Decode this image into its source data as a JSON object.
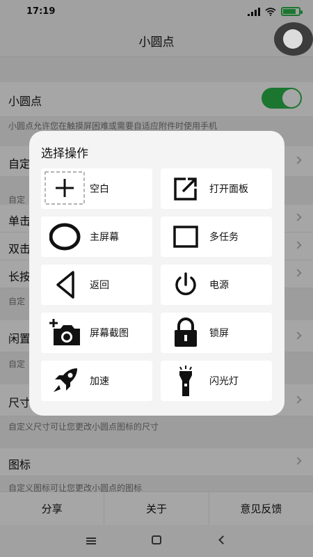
{
  "status_bar": {
    "time": "17:19"
  },
  "header": {
    "title": "小圆点"
  },
  "settings": {
    "dot_title": "小圆点",
    "dot_desc": "小圆点允许您在触摸屏困难或需要自适应附件时使用手机",
    "custom_menu": "自定",
    "custom_section": "自定",
    "single_tap": "单击",
    "double_tap": "双击",
    "long_press": "长按",
    "custom_desc": "自定",
    "idle": "闲置",
    "idle_desc": "自定",
    "size": "尺寸",
    "size_desc": "自定义尺寸可让您更改小圆点图标的尺寸",
    "icon": "图标",
    "icon_desc": "自定义图标可让您更改小圆点的图标",
    "dot_enabled": true
  },
  "bottom_tabs": {
    "share": "分享",
    "about": "关于",
    "feedback": "意见反馈"
  },
  "dialog": {
    "title": "选择操作",
    "actions": [
      {
        "label": "空白",
        "icon": "blank-plus-icon"
      },
      {
        "label": "打开面板",
        "icon": "open-panel-icon"
      },
      {
        "label": "主屏幕",
        "icon": "home-circle-icon"
      },
      {
        "label": "多任务",
        "icon": "multitask-square-icon"
      },
      {
        "label": "返回",
        "icon": "back-triangle-icon"
      },
      {
        "label": "电源",
        "icon": "power-icon"
      },
      {
        "label": "屏幕截图",
        "icon": "screenshot-camera-icon"
      },
      {
        "label": "锁屏",
        "icon": "lock-icon"
      },
      {
        "label": "加速",
        "icon": "rocket-icon"
      },
      {
        "label": "闪光灯",
        "icon": "flashlight-icon"
      }
    ]
  },
  "colors": {
    "accent": "#2bb64a",
    "scrim": "#000000",
    "dialog_bg": "#f4f4f4"
  }
}
